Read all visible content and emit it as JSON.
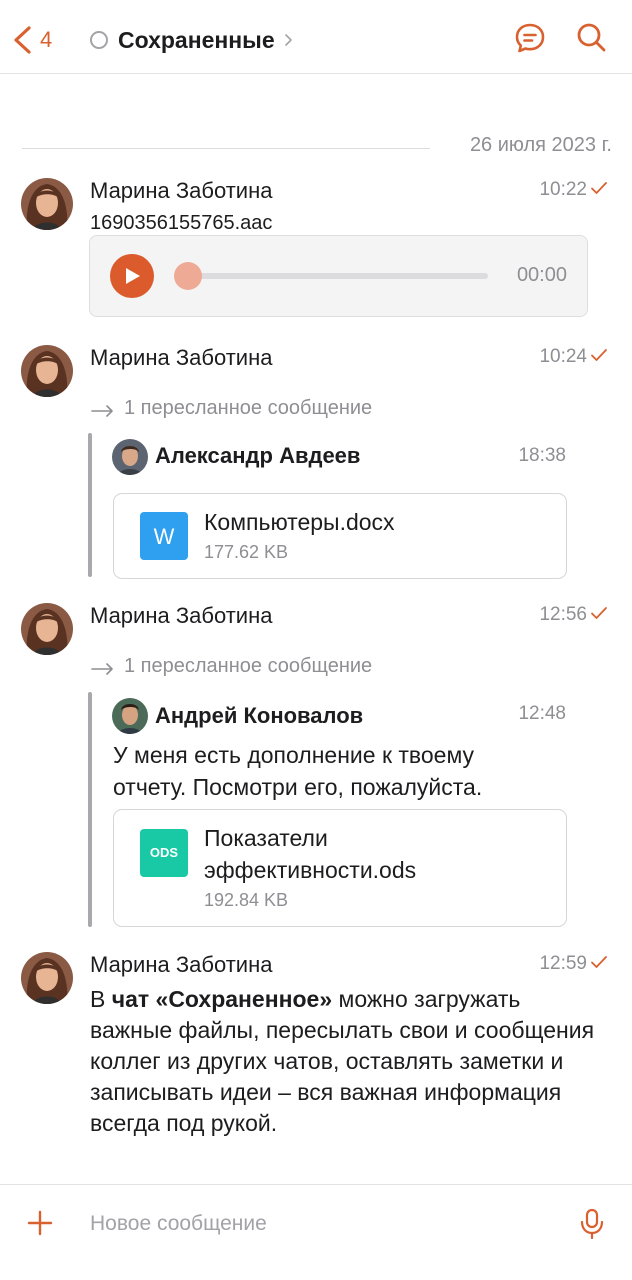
{
  "header": {
    "back_count": "4",
    "title": "Сохраненные",
    "accent_color": "#d9612f"
  },
  "date_separator": "26 июля 2023 г.",
  "messages": [
    {
      "sender": "Марина Заботина",
      "time": "10:22",
      "file_name": "1690356155765.aac",
      "audio_time": "00:00",
      "audio_progress": 0
    },
    {
      "sender": "Марина Заботина",
      "time": "10:24",
      "forward_label": "1 пересланное сообщение",
      "forwarded": {
        "sender": "Александр Авдеев",
        "time": "18:38",
        "file": {
          "name": "Компьютеры.docx",
          "size": "177.62 KB",
          "icon_letter": "W"
        }
      }
    },
    {
      "sender": "Марина Заботина",
      "time": "12:56",
      "forward_label": "1 пересланное сообщение",
      "forwarded": {
        "sender": "Андрей Коновалов",
        "time": "12:48",
        "text_line1": "У меня есть дополнение к твоему",
        "text_line2": "отчету. Посмотри его, пожалуйста.",
        "file": {
          "name_line1": "Показатели",
          "name_line2": "эффективности.ods",
          "size": "192.84 KB",
          "icon_letter": "ODS"
        }
      }
    },
    {
      "sender": "Марина Заботина",
      "time": "12:59",
      "text_prefix": "В ",
      "text_bold": "чат «Сохраненное»",
      "text_rest": " можно загружать важные файлы, пересылать свои и сообщения коллег из других чатов, оставлять заметки и записывать идеи – вся важная информация всегда под рукой."
    }
  ],
  "composer": {
    "placeholder": "Новое сообщение"
  }
}
